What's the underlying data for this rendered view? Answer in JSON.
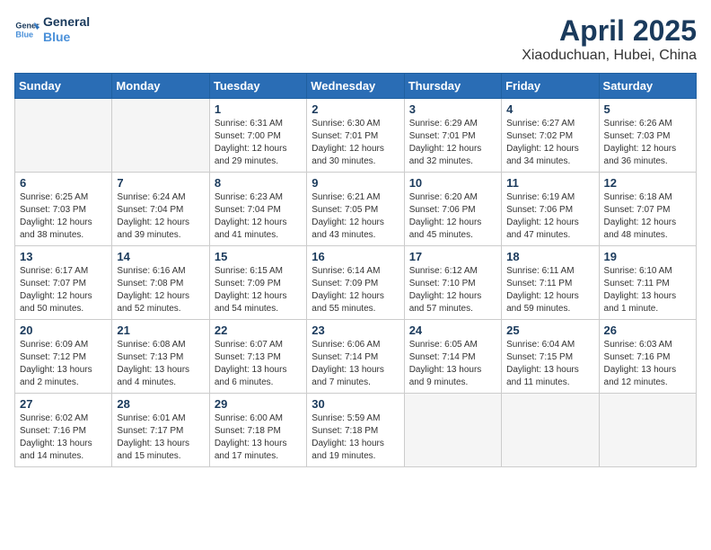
{
  "header": {
    "logo_line1": "General",
    "logo_line2": "Blue",
    "month": "April 2025",
    "location": "Xiaoduchuan, Hubei, China"
  },
  "weekdays": [
    "Sunday",
    "Monday",
    "Tuesday",
    "Wednesday",
    "Thursday",
    "Friday",
    "Saturday"
  ],
  "weeks": [
    [
      {
        "day": "",
        "info": ""
      },
      {
        "day": "",
        "info": ""
      },
      {
        "day": "1",
        "info": "Sunrise: 6:31 AM\nSunset: 7:00 PM\nDaylight: 12 hours\nand 29 minutes."
      },
      {
        "day": "2",
        "info": "Sunrise: 6:30 AM\nSunset: 7:01 PM\nDaylight: 12 hours\nand 30 minutes."
      },
      {
        "day": "3",
        "info": "Sunrise: 6:29 AM\nSunset: 7:01 PM\nDaylight: 12 hours\nand 32 minutes."
      },
      {
        "day": "4",
        "info": "Sunrise: 6:27 AM\nSunset: 7:02 PM\nDaylight: 12 hours\nand 34 minutes."
      },
      {
        "day": "5",
        "info": "Sunrise: 6:26 AM\nSunset: 7:03 PM\nDaylight: 12 hours\nand 36 minutes."
      }
    ],
    [
      {
        "day": "6",
        "info": "Sunrise: 6:25 AM\nSunset: 7:03 PM\nDaylight: 12 hours\nand 38 minutes."
      },
      {
        "day": "7",
        "info": "Sunrise: 6:24 AM\nSunset: 7:04 PM\nDaylight: 12 hours\nand 39 minutes."
      },
      {
        "day": "8",
        "info": "Sunrise: 6:23 AM\nSunset: 7:04 PM\nDaylight: 12 hours\nand 41 minutes."
      },
      {
        "day": "9",
        "info": "Sunrise: 6:21 AM\nSunset: 7:05 PM\nDaylight: 12 hours\nand 43 minutes."
      },
      {
        "day": "10",
        "info": "Sunrise: 6:20 AM\nSunset: 7:06 PM\nDaylight: 12 hours\nand 45 minutes."
      },
      {
        "day": "11",
        "info": "Sunrise: 6:19 AM\nSunset: 7:06 PM\nDaylight: 12 hours\nand 47 minutes."
      },
      {
        "day": "12",
        "info": "Sunrise: 6:18 AM\nSunset: 7:07 PM\nDaylight: 12 hours\nand 48 minutes."
      }
    ],
    [
      {
        "day": "13",
        "info": "Sunrise: 6:17 AM\nSunset: 7:07 PM\nDaylight: 12 hours\nand 50 minutes."
      },
      {
        "day": "14",
        "info": "Sunrise: 6:16 AM\nSunset: 7:08 PM\nDaylight: 12 hours\nand 52 minutes."
      },
      {
        "day": "15",
        "info": "Sunrise: 6:15 AM\nSunset: 7:09 PM\nDaylight: 12 hours\nand 54 minutes."
      },
      {
        "day": "16",
        "info": "Sunrise: 6:14 AM\nSunset: 7:09 PM\nDaylight: 12 hours\nand 55 minutes."
      },
      {
        "day": "17",
        "info": "Sunrise: 6:12 AM\nSunset: 7:10 PM\nDaylight: 12 hours\nand 57 minutes."
      },
      {
        "day": "18",
        "info": "Sunrise: 6:11 AM\nSunset: 7:11 PM\nDaylight: 12 hours\nand 59 minutes."
      },
      {
        "day": "19",
        "info": "Sunrise: 6:10 AM\nSunset: 7:11 PM\nDaylight: 13 hours\nand 1 minute."
      }
    ],
    [
      {
        "day": "20",
        "info": "Sunrise: 6:09 AM\nSunset: 7:12 PM\nDaylight: 13 hours\nand 2 minutes."
      },
      {
        "day": "21",
        "info": "Sunrise: 6:08 AM\nSunset: 7:13 PM\nDaylight: 13 hours\nand 4 minutes."
      },
      {
        "day": "22",
        "info": "Sunrise: 6:07 AM\nSunset: 7:13 PM\nDaylight: 13 hours\nand 6 minutes."
      },
      {
        "day": "23",
        "info": "Sunrise: 6:06 AM\nSunset: 7:14 PM\nDaylight: 13 hours\nand 7 minutes."
      },
      {
        "day": "24",
        "info": "Sunrise: 6:05 AM\nSunset: 7:14 PM\nDaylight: 13 hours\nand 9 minutes."
      },
      {
        "day": "25",
        "info": "Sunrise: 6:04 AM\nSunset: 7:15 PM\nDaylight: 13 hours\nand 11 minutes."
      },
      {
        "day": "26",
        "info": "Sunrise: 6:03 AM\nSunset: 7:16 PM\nDaylight: 13 hours\nand 12 minutes."
      }
    ],
    [
      {
        "day": "27",
        "info": "Sunrise: 6:02 AM\nSunset: 7:16 PM\nDaylight: 13 hours\nand 14 minutes."
      },
      {
        "day": "28",
        "info": "Sunrise: 6:01 AM\nSunset: 7:17 PM\nDaylight: 13 hours\nand 15 minutes."
      },
      {
        "day": "29",
        "info": "Sunrise: 6:00 AM\nSunset: 7:18 PM\nDaylight: 13 hours\nand 17 minutes."
      },
      {
        "day": "30",
        "info": "Sunrise: 5:59 AM\nSunset: 7:18 PM\nDaylight: 13 hours\nand 19 minutes."
      },
      {
        "day": "",
        "info": ""
      },
      {
        "day": "",
        "info": ""
      },
      {
        "day": "",
        "info": ""
      }
    ]
  ]
}
